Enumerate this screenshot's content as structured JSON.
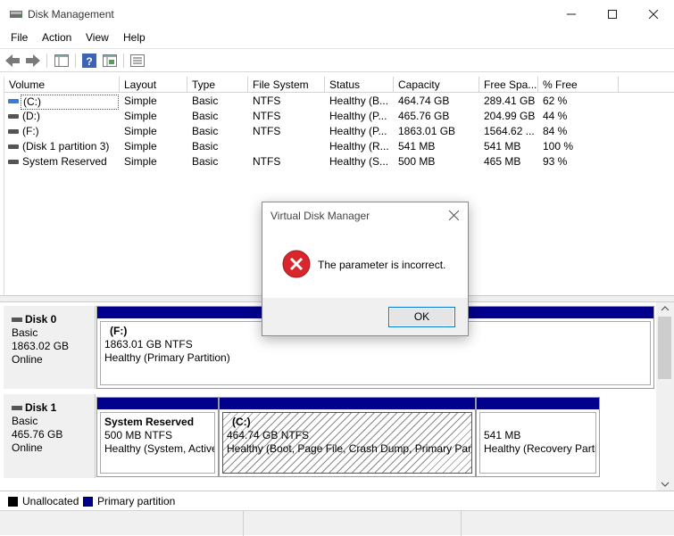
{
  "window": {
    "title": "Disk Management"
  },
  "menu": [
    "File",
    "Action",
    "View",
    "Help"
  ],
  "volume_table": {
    "columns": [
      "Volume",
      "Layout",
      "Type",
      "File System",
      "Status",
      "Capacity",
      "Free Spa...",
      "% Free"
    ],
    "rows": [
      [
        "(C:)",
        "Simple",
        "Basic",
        "NTFS",
        "Healthy (B...",
        "464.74 GB",
        "289.41 GB",
        "62 %"
      ],
      [
        "(D:)",
        "Simple",
        "Basic",
        "NTFS",
        "Healthy (P...",
        "465.76 GB",
        "204.99 GB",
        "44 %"
      ],
      [
        "(F:)",
        "Simple",
        "Basic",
        "NTFS",
        "Healthy (P...",
        "1863.01 GB",
        "1564.62 ...",
        "84 %"
      ],
      [
        "(Disk 1 partition 3)",
        "Simple",
        "Basic",
        "",
        "Healthy (R...",
        "541 MB",
        "541 MB",
        "100 %"
      ],
      [
        "System Reserved",
        "Simple",
        "Basic",
        "NTFS",
        "Healthy (S...",
        "500 MB",
        "465 MB",
        "93 %"
      ]
    ]
  },
  "disks": [
    {
      "name": "Disk 0",
      "type": "Basic",
      "size": "1863.02 GB",
      "state": "Online",
      "partitions": [
        {
          "title": "(F:)",
          "line1": "1863.01 GB NTFS",
          "line2": "Healthy (Primary Partition)"
        }
      ]
    },
    {
      "name": "Disk 1",
      "type": "Basic",
      "size": "465.76 GB",
      "state": "Online",
      "partitions": [
        {
          "title": "System Reserved",
          "line1": "500 MB NTFS",
          "line2": "Healthy (System, Active"
        },
        {
          "title": "(C:)",
          "line1": "464.74 GB NTFS",
          "line2": "Healthy (Boot, Page File, Crash Dump, Primary Parti"
        },
        {
          "title": "",
          "line1": "541 MB",
          "line2": "Healthy (Recovery Parti"
        }
      ]
    }
  ],
  "legend": [
    {
      "label": "Unallocated",
      "color": "#000000"
    },
    {
      "label": "Primary partition",
      "color": "#00008b"
    }
  ],
  "dialog": {
    "title": "Virtual Disk Manager",
    "message": "The parameter is incorrect.",
    "ok_label": "OK"
  },
  "colors": {
    "primary_partition": "#00008b",
    "accent": "#0078d7",
    "error": "#d9262c"
  }
}
